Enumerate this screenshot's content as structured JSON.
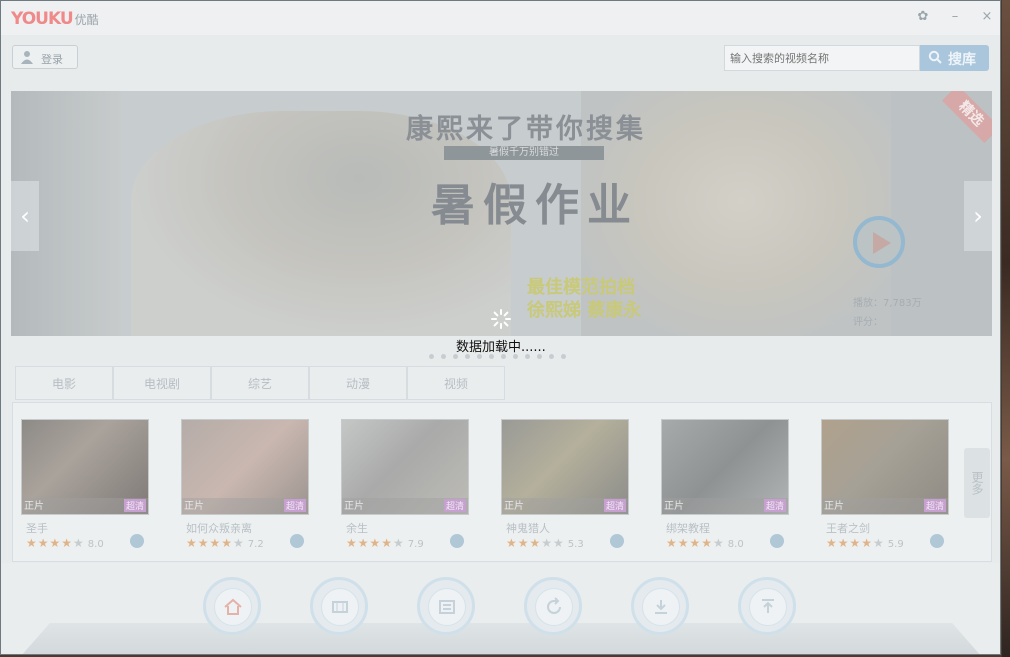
{
  "app": {
    "logo": "YOUKU",
    "logo_sub": "优酷",
    "window_controls": [
      "gear-icon",
      "minimize-icon",
      "close-icon"
    ]
  },
  "header": {
    "login_label": "登录",
    "search_placeholder": "输入搜索的视频名称",
    "search_button": "搜库"
  },
  "banner": {
    "title": "康熙来了带你搜集",
    "subtitle": "暑假千万别错过",
    "headline": "暑假作业",
    "caption1": "最佳模范拍档",
    "caption2": "徐熙娣 蔡康永",
    "tag": "精选",
    "info1": "播放：7,783万",
    "info2": "评分："
  },
  "loading": {
    "text": "数据加载中......"
  },
  "tabs": [
    "电影",
    "电视剧",
    "综艺",
    "动漫",
    "视频"
  ],
  "movies": [
    {
      "title": "圣手",
      "badge_left": "正片",
      "badge_right": "超清",
      "rating": 4,
      "score": "8.0"
    },
    {
      "title": "如何众叛亲离",
      "badge_left": "正片",
      "badge_right": "超清",
      "rating": 4,
      "score": "7.2"
    },
    {
      "title": "余生",
      "badge_left": "正片",
      "badge_right": "超清",
      "rating": 4,
      "score": "7.9"
    },
    {
      "title": "神鬼猎人",
      "badge_left": "正片",
      "badge_right": "超清",
      "rating": 3,
      "score": "5.3"
    },
    {
      "title": "绑架教程",
      "badge_left": "正片",
      "badge_right": "超清",
      "rating": 4,
      "score": "8.0"
    },
    {
      "title": "王者之剑",
      "badge_left": "正片",
      "badge_right": "超清",
      "rating": 4,
      "score": "5.9"
    }
  ],
  "more_label": "更多",
  "dock": [
    "home-icon",
    "film-icon",
    "list-icon",
    "refresh-icon",
    "download-icon",
    "upload-icon"
  ],
  "colors": {
    "accent": "#a9c6dc",
    "logo": "#f08a8a",
    "star": "#e0b48a"
  }
}
